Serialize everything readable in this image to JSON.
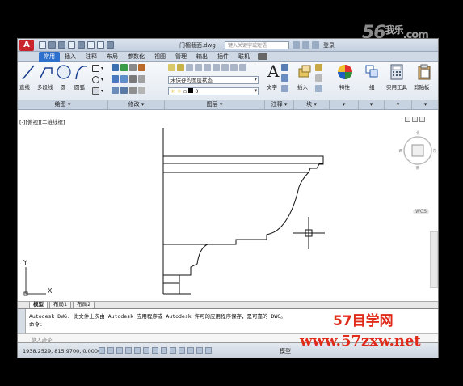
{
  "watermark": {
    "top_brand": "56",
    "top_cn": "我乐",
    "top_sub": ".com",
    "bottom_title": "57目学网",
    "bottom_url": "www.57zxw.net"
  },
  "titlebar": {
    "doc_title": "门楣截面.dwg",
    "search_placeholder": "键入关键字或短语",
    "login": "登录"
  },
  "ribbon_tabs": [
    "常用",
    "插入",
    "注释",
    "布局",
    "参数化",
    "视图",
    "管理",
    "输出",
    "插件",
    "联机"
  ],
  "ribbon": {
    "draw": {
      "line": "直线",
      "polyline": "多段线",
      "circle": "圆",
      "arc": "圆弧",
      "footer": "绘图"
    },
    "modify": {
      "footer": "修改"
    },
    "layers": {
      "layer_state": "未保存的图层状态",
      "layer_current": "0",
      "footer": "图层"
    },
    "annotation": {
      "text": "文字",
      "footer": "注释"
    },
    "block": {
      "insert": "插入",
      "footer": "块"
    },
    "properties": {
      "label": "特性"
    },
    "groups": {
      "label": "组"
    },
    "utilities": {
      "label": "实用工具"
    },
    "clipboard": {
      "label": "剪贴板"
    }
  },
  "canvas": {
    "viewport_label": "[-][俯视][二维线框]",
    "wcs": "WCS",
    "ucs_x": "X",
    "ucs_y": "Y"
  },
  "layout_tabs": [
    "模型",
    "布局1",
    "布局2"
  ],
  "command": {
    "history": "Autodesk DWG.  此文件上次由 Autodesk 应用程序或 Autodesk 许可的应用程序保存，是可靠的 DWG。",
    "history2": "命令:",
    "placeholder": "键入命令"
  },
  "statusbar": {
    "coords": "1938.2529, 815.9700, 0.0000",
    "model": "模型"
  },
  "colors": {
    "accent": "#2d6fcc",
    "watermark_red": "#e02a1a"
  }
}
